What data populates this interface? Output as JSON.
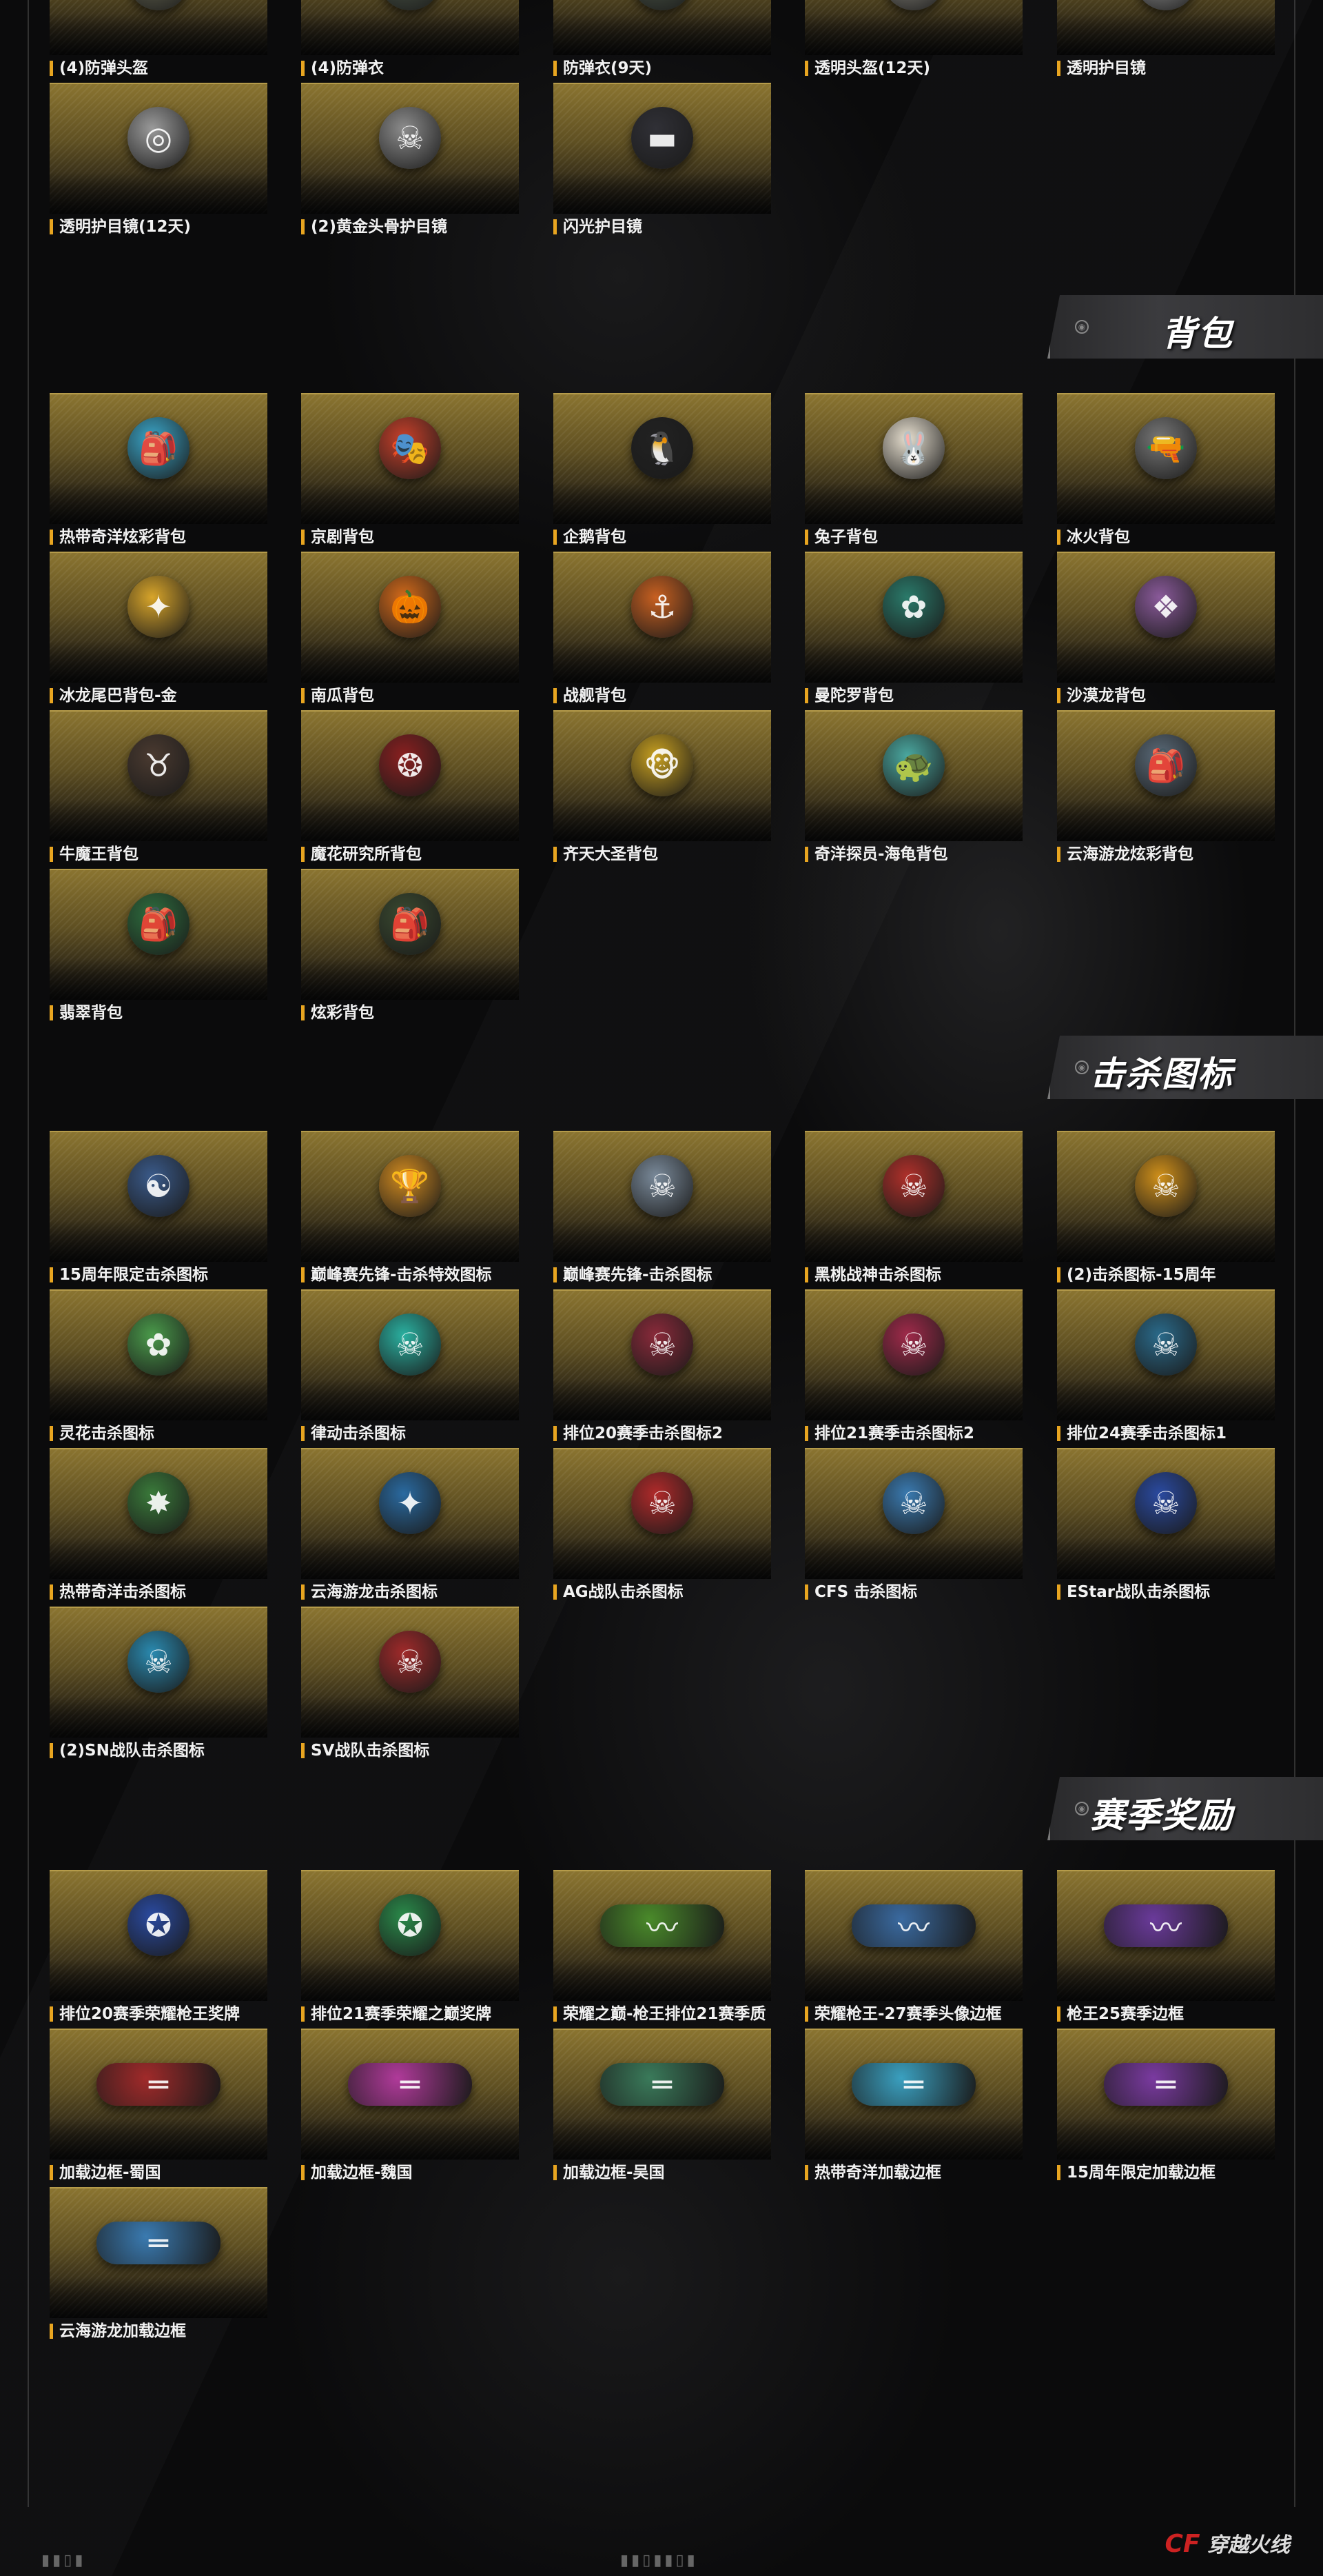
{
  "sections": {
    "armor": {
      "title": ""
    },
    "backpack": {
      "title": "背包"
    },
    "kill_icons": {
      "title": "击杀图标"
    },
    "season_rewards": {
      "title": "赛季奖励"
    }
  },
  "items": [
    {
      "name": "(4)防弹头盔",
      "tile_text": "防弹头盔",
      "icon": "helmet-icon",
      "glyph": "⛑",
      "color": "#6b6b55"
    },
    {
      "name": "(4)防弹衣",
      "tile_text": "防弹衣",
      "icon": "vest-icon",
      "glyph": "🦺",
      "color": "#4e5a4a"
    },
    {
      "name": "防弹衣(9天)",
      "tile_text": "防弹衣",
      "icon": "vest-icon",
      "glyph": "🦺",
      "color": "#4e5a4a"
    },
    {
      "name": "透明头盔(12天)",
      "icon": "helmet-icon",
      "glyph": "⛑",
      "color": "#8d8a80"
    },
    {
      "name": "透明护目镜",
      "icon": "goggles-icon",
      "glyph": "◎",
      "color": "#9a9a9a"
    },
    {
      "name": "透明护目镜(12天)",
      "icon": "goggles-icon",
      "glyph": "◎",
      "color": "#9a9a9a"
    },
    {
      "name": "(2)黄金头骨护目镜",
      "icon": "skull-icon",
      "glyph": "☠",
      "color": "#8c8c8c"
    },
    {
      "name": "闪光护目镜",
      "icon": "goggles-icon",
      "glyph": "▬",
      "color": "#303036"
    },
    {
      "name": "热带奇洋炫彩背包",
      "icon": "backpack-icon",
      "glyph": "🎒",
      "color": "#3aa6c9"
    },
    {
      "name": "京剧背包",
      "icon": "backpack-icon",
      "glyph": "🎭",
      "color": "#c8402a"
    },
    {
      "name": "企鹅背包",
      "icon": "penguin-icon",
      "glyph": "🐧",
      "color": "#222"
    },
    {
      "name": "兔子背包",
      "icon": "rabbit-icon",
      "glyph": "🐰",
      "color": "#e8e0d0"
    },
    {
      "name": "冰火背包",
      "icon": "backpack-icon",
      "glyph": "🔫",
      "color": "#777"
    },
    {
      "name": "冰龙尾巴背包-金",
      "icon": "backpack-icon",
      "glyph": "✦",
      "color": "#d8a52a"
    },
    {
      "name": "南瓜背包",
      "icon": "pumpkin-icon",
      "glyph": "🎃",
      "color": "#d46a1a"
    },
    {
      "name": "战舰背包",
      "icon": "backpack-icon",
      "glyph": "⚓",
      "color": "#c86020"
    },
    {
      "name": "曼陀罗背包",
      "icon": "backpack-icon",
      "glyph": "✿",
      "color": "#2a7a6a"
    },
    {
      "name": "沙漠龙背包",
      "icon": "backpack-icon",
      "glyph": "❖",
      "color": "#8a5a9a"
    },
    {
      "name": "牛魔王背包",
      "icon": "backpack-icon",
      "glyph": "♉",
      "color": "#4a3a30"
    },
    {
      "name": "魔花研究所背包",
      "icon": "backpack-icon",
      "glyph": "❂",
      "color": "#8a2020"
    },
    {
      "name": "齐天大圣背包",
      "icon": "backpack-icon",
      "glyph": "🐵",
      "color": "#c8a020"
    },
    {
      "name": "奇洋探员-海龟背包",
      "icon": "turtle-icon",
      "glyph": "🐢",
      "color": "#4aa8a0"
    },
    {
      "name": "云海游龙炫彩背包",
      "icon": "backpack-icon",
      "glyph": "🎒",
      "color": "#5a6a78"
    },
    {
      "name": "翡翠背包",
      "icon": "backpack-icon",
      "glyph": "🎒",
      "color": "#2e6e3e"
    },
    {
      "name": "炫彩背包",
      "icon": "backpack-icon",
      "glyph": "🎒",
      "color": "#3a4a30"
    },
    {
      "name": "15周年限定击杀图标",
      "icon": "kill-badge-icon",
      "glyph": "☯",
      "color": "#3a5a8a"
    },
    {
      "name": "巅峰赛先锋-击杀特效图标",
      "icon": "trophy-icon",
      "glyph": "🏆",
      "color": "#d08a20"
    },
    {
      "name": "巅峰赛先锋-击杀图标",
      "icon": "skull-badge-icon",
      "glyph": "☠",
      "color": "#7a8a9a"
    },
    {
      "name": "黑桃战神击杀图标",
      "icon": "skull-badge-icon",
      "glyph": "☠",
      "color": "#b0302a"
    },
    {
      "name": "(2)击杀图标-15周年",
      "icon": "skull-badge-icon",
      "glyph": "☠",
      "color": "#d0901a"
    },
    {
      "name": "灵花击杀图标",
      "icon": "flower-badge-icon",
      "glyph": "✿",
      "color": "#4a9a4a"
    },
    {
      "name": "律动击杀图标",
      "icon": "skull-badge-icon",
      "glyph": "☠",
      "color": "#2ab0a0"
    },
    {
      "name": "排位20赛季击杀图标2",
      "icon": "skull-badge-icon",
      "glyph": "☠",
      "color": "#8a2a3a"
    },
    {
      "name": "排位21赛季击杀图标2",
      "icon": "skull-badge-icon",
      "glyph": "☠",
      "color": "#a02a4a"
    },
    {
      "name": "排位24赛季击杀图标1",
      "icon": "skull-badge-icon",
      "glyph": "☠",
      "color": "#2a6a8a"
    },
    {
      "name": "热带奇洋击杀图标",
      "icon": "star-badge-icon",
      "glyph": "✸",
      "color": "#3a7a3a"
    },
    {
      "name": "云海游龙击杀图标",
      "icon": "star-badge-icon",
      "glyph": "✦",
      "color": "#2a6aa0"
    },
    {
      "name": "AG战队击杀图标",
      "icon": "skull-badge-icon",
      "glyph": "☠",
      "color": "#b02a2a"
    },
    {
      "name": "CFS 击杀图标",
      "icon": "skull-badge-icon",
      "glyph": "☠",
      "color": "#3a7ab0"
    },
    {
      "name": "EStar战队击杀图标",
      "icon": "skull-badge-icon",
      "glyph": "☠",
      "color": "#2a4aa0"
    },
    {
      "name": "(2)SN战队击杀图标",
      "icon": "skull-badge-icon",
      "glyph": "☠",
      "color": "#2a8ab0"
    },
    {
      "name": "SV战队击杀图标",
      "icon": "skull-badge-icon",
      "glyph": "☠",
      "color": "#a02a2a"
    },
    {
      "name": "排位20赛季荣耀枪王奖牌",
      "icon": "medal-icon",
      "glyph": "✪",
      "color": "#2a4aa0"
    },
    {
      "name": "排位21赛季荣耀之巅奖牌",
      "icon": "medal-icon",
      "glyph": "✪",
      "color": "#2a8a4a"
    },
    {
      "name": "荣耀之巅-枪王排位21赛季质",
      "icon": "avatar-frame-icon",
      "glyph": "〰",
      "color": "#4a8a2a",
      "wide": true
    },
    {
      "name": "荣耀枪王-27赛季头像边框",
      "icon": "avatar-frame-icon",
      "glyph": "〰",
      "color": "#3a6aa0",
      "wide": true
    },
    {
      "name": "枪王25赛季边框",
      "icon": "avatar-frame-icon",
      "glyph": "〰",
      "color": "#6a3a9a",
      "wide": true
    },
    {
      "name": "加载边框-蜀国",
      "icon": "loading-frame-icon",
      "glyph": "═",
      "color": "#a02a2a",
      "wide": true
    },
    {
      "name": "加载边框-魏国",
      "icon": "loading-frame-icon",
      "glyph": "═",
      "color": "#b03a9a",
      "wide": true
    },
    {
      "name": "加载边框-吴国",
      "icon": "loading-frame-icon",
      "glyph": "═",
      "color": "#3a7a5a",
      "wide": true
    },
    {
      "name": "热带奇洋加载边框",
      "icon": "loading-frame-icon",
      "glyph": "═",
      "color": "#3aa0c0",
      "wide": true
    },
    {
      "name": "15周年限定加载边框",
      "icon": "loading-frame-icon",
      "glyph": "═",
      "color": "#7a3aa0",
      "wide": true
    },
    {
      "name": "云海游龙加载边框",
      "icon": "loading-frame-icon",
      "glyph": "═",
      "color": "#3a7ab0",
      "wide": true
    }
  ],
  "footer": {
    "logo_mark": "CF",
    "logo_text": "穿越火线"
  }
}
